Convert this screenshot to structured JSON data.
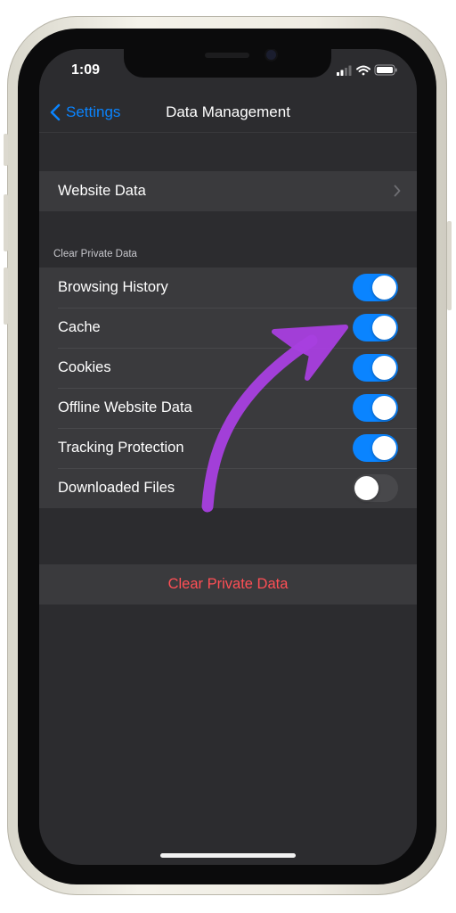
{
  "status_bar": {
    "time": "1:09"
  },
  "nav": {
    "back_label": "Settings",
    "title": "Data Management"
  },
  "website_data": {
    "label": "Website Data"
  },
  "section": {
    "header": "Clear Private Data"
  },
  "toggles": [
    {
      "label": "Browsing History",
      "on": true
    },
    {
      "label": "Cache",
      "on": true
    },
    {
      "label": "Cookies",
      "on": true
    },
    {
      "label": "Offline Website Data",
      "on": true
    },
    {
      "label": "Tracking Protection",
      "on": true
    },
    {
      "label": "Downloaded Files",
      "on": false
    }
  ],
  "action": {
    "label": "Clear Private Data"
  },
  "colors": {
    "accent": "#0a84ff",
    "destructive": "#ff4f55",
    "annotation_arrow": "#a83fe0",
    "background": "#2c2c2f",
    "cell": "#3a3a3d"
  },
  "icons": [
    "back-chevron-icon",
    "chevron-right-icon",
    "signal-icon",
    "wifi-icon",
    "battery-icon",
    "annotation-arrow-icon"
  ]
}
